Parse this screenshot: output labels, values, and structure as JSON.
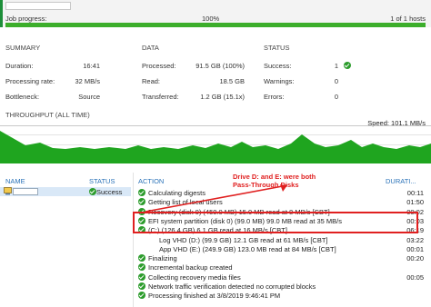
{
  "header": {
    "job_progress_label": "Job progress:",
    "job_progress_value": "100%",
    "job_progress_fraction": 1.0,
    "hosts_label": "1 of 1 hosts"
  },
  "summary": {
    "title": "SUMMARY",
    "rows": [
      {
        "label": "Duration:",
        "value": "16:41"
      },
      {
        "label": "Processing rate:",
        "value": "32 MB/s"
      },
      {
        "label": "Bottleneck:",
        "value": "Source"
      }
    ]
  },
  "data": {
    "title": "DATA",
    "rows": [
      {
        "label": "Processed:",
        "value": "91.5 GB (100%)"
      },
      {
        "label": "Read:",
        "value": "18.5 GB"
      },
      {
        "label": "Transferred:",
        "value": "1.2 GB (15.1x)"
      }
    ]
  },
  "status": {
    "title": "STATUS",
    "rows": [
      {
        "label": "Success:",
        "value": "1",
        "icon": "success-icon"
      },
      {
        "label": "Warnings:",
        "value": "0"
      },
      {
        "label": "Errors:",
        "value": "0"
      }
    ]
  },
  "throughput": {
    "title": "THROUGHPUT (ALL TIME)",
    "speed": "Speed: 101.1 MB/s",
    "fill_color": "#1fa51f"
  },
  "objects": {
    "name_header": "NAME",
    "status_header": "STATUS",
    "row_status": "Success"
  },
  "log": {
    "action_header": "ACTION",
    "duration_header": "DURATI...",
    "entries": [
      {
        "text": "Calculating digests",
        "dur": "00:11"
      },
      {
        "text": "Getting list of local users",
        "dur": "01:50"
      },
      {
        "text": "Recovery (disk 0) (450.0 MB) 15.0 MB read at 8 MB/s [CBT]",
        "dur": "00:02"
      },
      {
        "text": "EFI system partition (disk 0) (99.0 MB) 99.0 MB read at 35 MB/s",
        "dur": "00:03"
      },
      {
        "text": "(C:) (126.4 GB) 6.1 GB read at 16 MB/s [CBT]",
        "dur": "06:19"
      },
      {
        "text": "Log VHD (D:) (99.9 GB) 12.1 GB read at 61 MB/s [CBT]",
        "dur": "03:22"
      },
      {
        "text": "App VHD (E:) (249.9 GB) 123.0 MB read at 84 MB/s [CBT]",
        "dur": "00:01"
      },
      {
        "text": "Finalizing",
        "dur": "00:20"
      },
      {
        "text": "Incremental backup created",
        "dur": ""
      },
      {
        "text": "Collecting recovery media files",
        "dur": "00:05"
      },
      {
        "text": "Network traffic verification detected no corrupted blocks",
        "dur": ""
      },
      {
        "text": "Processing finished at 3/8/2019 9:46:41 PM",
        "dur": ""
      }
    ]
  },
  "annotation": {
    "text": "Drive D: and E: were both Pass-Through Disks",
    "color": "#e02020"
  }
}
